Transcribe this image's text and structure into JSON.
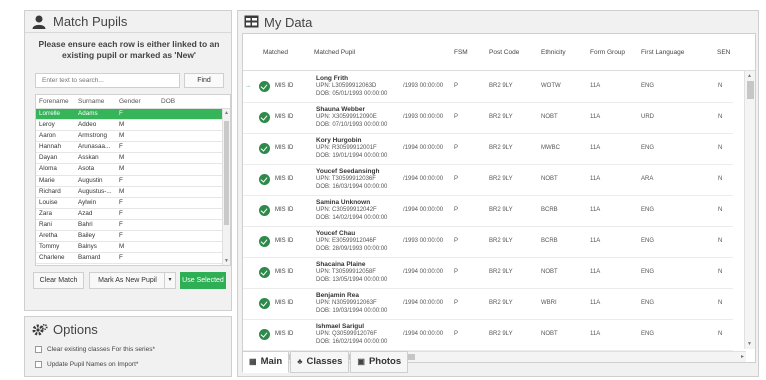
{
  "match": {
    "title": "Match Pupils",
    "instruction": "Please ensure each row is either linked to an existing pupil or marked as 'New'",
    "search_placeholder": "Enter text to search...",
    "find_label": "Find",
    "columns": [
      "Forename",
      "Surname",
      "Gender",
      "DOB"
    ],
    "rows": [
      {
        "forename": "Lorrelle",
        "surname": "Adams",
        "gender": "F",
        "dob": "",
        "selected": true
      },
      {
        "forename": "Leroy",
        "surname": "Addeo",
        "gender": "M",
        "dob": ""
      },
      {
        "forename": "Aaron",
        "surname": "Armstrong",
        "gender": "M",
        "dob": ""
      },
      {
        "forename": "Hannah",
        "surname": "Arunasaa...",
        "gender": "F",
        "dob": ""
      },
      {
        "forename": "Dayan",
        "surname": "Asskan",
        "gender": "M",
        "dob": ""
      },
      {
        "forename": "Aloma",
        "surname": "Asota",
        "gender": "M",
        "dob": ""
      },
      {
        "forename": "Marie",
        "surname": "Augustin",
        "gender": "F",
        "dob": ""
      },
      {
        "forename": "Richard",
        "surname": "Augustus-...",
        "gender": "M",
        "dob": ""
      },
      {
        "forename": "Louise",
        "surname": "Aylwin",
        "gender": "F",
        "dob": ""
      },
      {
        "forename": "Zara",
        "surname": "Azad",
        "gender": "F",
        "dob": ""
      },
      {
        "forename": "Rani",
        "surname": "Bahri",
        "gender": "F",
        "dob": ""
      },
      {
        "forename": "Aretha",
        "surname": "Bailey",
        "gender": "F",
        "dob": ""
      },
      {
        "forename": "Tommy",
        "surname": "Balnys",
        "gender": "M",
        "dob": ""
      },
      {
        "forename": "Charlene",
        "surname": "Barnard",
        "gender": "F",
        "dob": ""
      }
    ],
    "clear_match_label": "Clear Match",
    "mark_new_label": "Mark As New Pupil",
    "use_selected_label": "Use Selected"
  },
  "options": {
    "title": "Options",
    "checkbox1": "Clear existing classes For this series*",
    "checkbox2": "Update Pupil Names on Import*"
  },
  "mydata": {
    "title": "My Data",
    "columns": [
      "Matched",
      "Matched Pupil",
      "FSM",
      "Post Code",
      "Ethnicity",
      "Form Group",
      "First Language",
      "SEN"
    ],
    "rows": [
      {
        "status": "MIS ID",
        "name": "Long Frith",
        "upn": "UPN: L30599912063D",
        "dob": "DOB: 05/01/1993 00:00:00",
        "date": "/1993 00:00:00",
        "fsm": "P",
        "post": "BR2 9LY",
        "eth": "WOTW",
        "form": "11A",
        "lang": "ENG",
        "sen": "N"
      },
      {
        "status": "MIS ID",
        "name": "Shauna Webber",
        "upn": "UPN: X30599912090E",
        "dob": "DOB: 07/10/1993 00:00:00",
        "date": "/1993 00:00:00",
        "fsm": "P",
        "post": "BR2 9LY",
        "eth": "NOBT",
        "form": "11A",
        "lang": "URD",
        "sen": "N"
      },
      {
        "status": "MIS ID",
        "name": "Kory Hurgobin",
        "upn": "UPN: R30599912001F",
        "dob": "DOB: 19/01/1994 00:00:00",
        "date": "/1994 00:00:00",
        "fsm": "P",
        "post": "BR2 9LY",
        "eth": "MWBC",
        "form": "11A",
        "lang": "ENG",
        "sen": "N"
      },
      {
        "status": "MIS ID",
        "name": "Youcef Seedansingh",
        "upn": "UPN: T30599912036F",
        "dob": "DOB: 16/03/1994 00:00:00",
        "date": "/1994 00:00:00",
        "fsm": "P",
        "post": "BR2 9LY",
        "eth": "NOBT",
        "form": "11A",
        "lang": "ARA",
        "sen": "N"
      },
      {
        "status": "MIS ID",
        "name": "Samina Unknown",
        "upn": "UPN: C30599912042F",
        "dob": "DOB: 14/02/1994 00:00:00",
        "date": "/1994 00:00:00",
        "fsm": "P",
        "post": "BR2 9LY",
        "eth": "BCRB",
        "form": "11A",
        "lang": "ENG",
        "sen": "N"
      },
      {
        "status": "MIS ID",
        "name": "Youcef Chau",
        "upn": "UPN: E30599912046F",
        "dob": "DOB: 28/09/1993 00:00:00",
        "date": "/1993 00:00:00",
        "fsm": "P",
        "post": "BR2 9LY",
        "eth": "BCRB",
        "form": "11A",
        "lang": "ENG",
        "sen": "N"
      },
      {
        "status": "MIS ID",
        "name": "Shacaina Plaine",
        "upn": "UPN: T30599912058F",
        "dob": "DOB: 13/05/1994 00:00:00",
        "date": "/1994 00:00:00",
        "fsm": "P",
        "post": "BR2 9LY",
        "eth": "NOBT",
        "form": "11A",
        "lang": "ENG",
        "sen": "N"
      },
      {
        "status": "MIS ID",
        "name": "Benjamin Rea",
        "upn": "UPN: N30599912063F",
        "dob": "DOB: 19/03/1994 00:00:00",
        "date": "/1994 00:00:00",
        "fsm": "P",
        "post": "BR2 9LY",
        "eth": "WBRI",
        "form": "11A",
        "lang": "ENG",
        "sen": "N"
      },
      {
        "status": "MIS ID",
        "name": "Ishmael Sarigul",
        "upn": "UPN: Q30599912076F",
        "dob": "DOB: 16/02/1994 00:00:00",
        "date": "/1994 00:00:00",
        "fsm": "P",
        "post": "BR2 9LY",
        "eth": "NOBT",
        "form": "11A",
        "lang": "ENG",
        "sen": "N"
      }
    ],
    "tabs": [
      "Main",
      "Classes",
      "Photos"
    ]
  }
}
